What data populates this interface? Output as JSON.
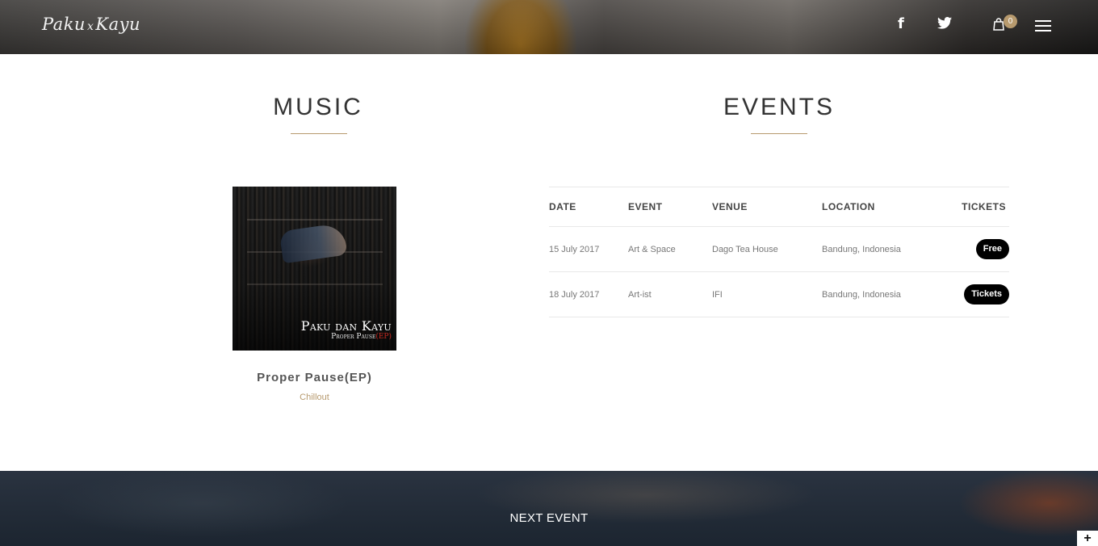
{
  "header": {
    "logo_left": "Paku",
    "logo_x": "x",
    "logo_right": "Kayu",
    "facebook_icon": "f",
    "twitter_icon": "🐦",
    "cart_icon": "🛍",
    "cart_count": "0"
  },
  "music": {
    "title": "MUSIC",
    "album": {
      "cover_title": "Paku dan Kayu",
      "cover_subtitle_main": "Proper Pause",
      "cover_subtitle_ep": "(EP)",
      "name": "Proper Pause(EP)",
      "genre": "Chillout"
    }
  },
  "events": {
    "title": "EVENTS",
    "columns": [
      "DATE",
      "EVENT",
      "VENUE",
      "LOCATION",
      "TICKETS"
    ],
    "rows": [
      {
        "date": "15 July 2017",
        "event": "Art & Space",
        "venue": "Dago Tea House",
        "location": "Bandung, Indonesia",
        "tickets": "Free"
      },
      {
        "date": "18 July 2017",
        "event": "Art-ist",
        "venue": "IFI",
        "location": "Bandung, Indonesia",
        "tickets": "Tickets"
      }
    ]
  },
  "next_event": {
    "label": "NEXT EVENT"
  },
  "corner_button": "+",
  "colors": {
    "accent": "#b79a6e",
    "ticket_button": "#000000"
  }
}
